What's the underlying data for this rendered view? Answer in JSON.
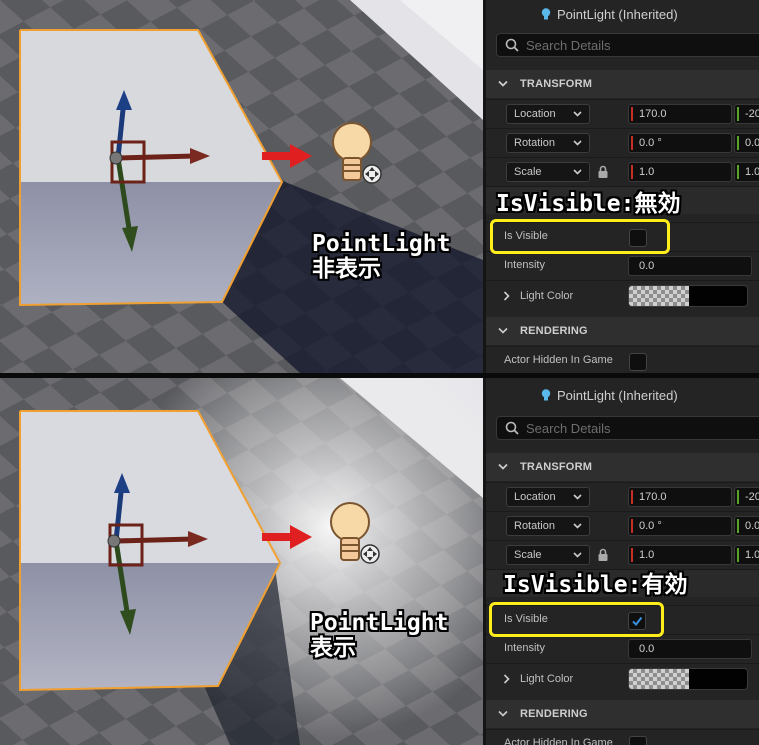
{
  "panels": [
    {
      "viewport_label_line1": "PointLight",
      "viewport_label_line2": "非表示",
      "annotation": "IsVisible:無効",
      "is_visible_checked": false,
      "details": {
        "title": "PointLight (Inherited)",
        "search_placeholder": "Search Details",
        "transform_header": "TRANSFORM",
        "location_label": "Location",
        "location_x": "170.0",
        "location_y": "-20",
        "rotation_label": "Rotation",
        "rotation_x": "0.0 °",
        "rotation_y": "0.0",
        "scale_label": "Scale",
        "scale_x": "1.0",
        "scale_y": "1.0",
        "is_visible_label": "Is Visible",
        "intensity_label": "Intensity",
        "intensity_value": "0.0",
        "light_color_label": "Light Color",
        "rendering_header": "RENDERING",
        "actor_hidden_label": "Actor Hidden In Game"
      }
    },
    {
      "viewport_label_line1": "PointLight",
      "viewport_label_line2": "表示",
      "annotation": "IsVisible:有効",
      "is_visible_checked": true,
      "details": {
        "title": "PointLight (Inherited)",
        "search_placeholder": "Search Details",
        "transform_header": "TRANSFORM",
        "location_label": "Location",
        "location_x": "170.0",
        "location_y": "-20",
        "rotation_label": "Rotation",
        "rotation_x": "0.0 °",
        "rotation_y": "0.0",
        "scale_label": "Scale",
        "scale_x": "1.0",
        "scale_y": "1.0",
        "is_visible_label": "Is Visible",
        "intensity_label": "Intensity",
        "intensity_value": "0.0",
        "light_color_label": "Light Color",
        "rendering_header": "RENDERING",
        "actor_hidden_label": "Actor Hidden In Game"
      }
    }
  ],
  "colors": {
    "highlight": "#ffee1a",
    "selection_outline": "#f0a030",
    "axis_x": "#c53026",
    "axis_y": "#5aa329",
    "checkbox_check": "#3a8fe0",
    "panel_bg": "#242424"
  },
  "icons": [
    "point-light-bulb-icon",
    "search-icon",
    "lock-icon",
    "chevron-down-icon",
    "chevron-right-icon",
    "checkmark-icon",
    "move-gizmo-icon"
  ]
}
